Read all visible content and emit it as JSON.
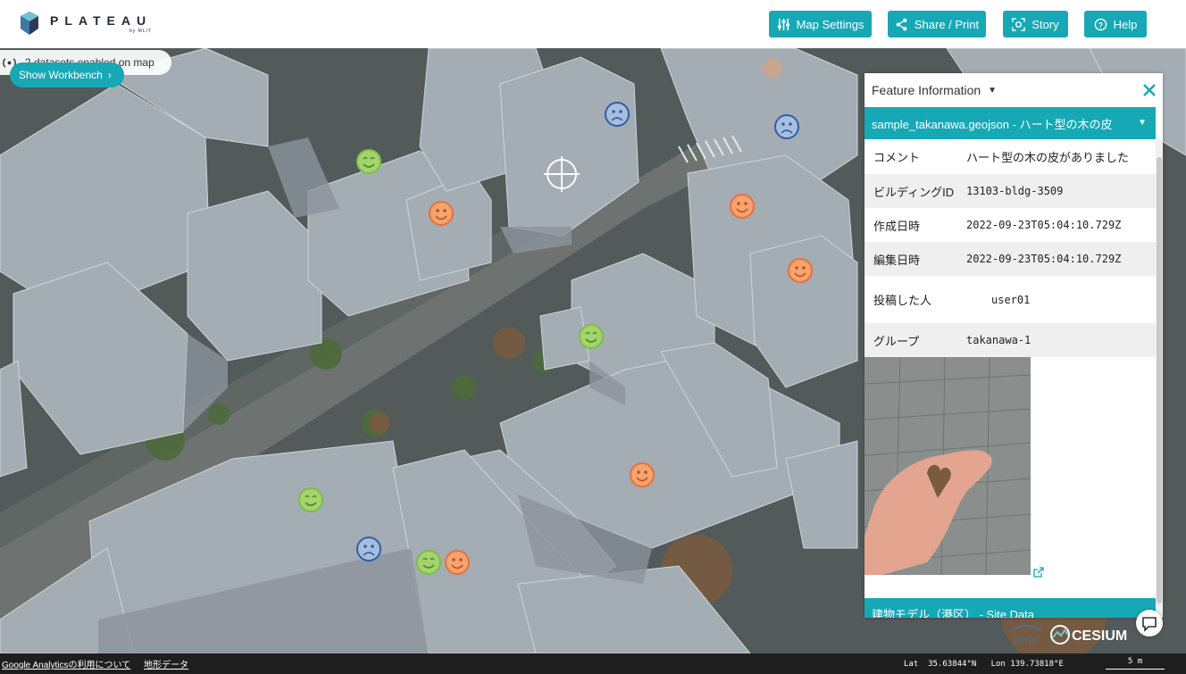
{
  "app": {
    "logo_title": "PLATEAU",
    "logo_sub": "by MLIT",
    "accent": "#17a8b5"
  },
  "header": {
    "buttons": [
      {
        "label": "Map Settings",
        "icon": "sliders-icon"
      },
      {
        "label": "Share / Print",
        "icon": "share-icon"
      },
      {
        "label": "Story",
        "icon": "story-icon"
      },
      {
        "label": "Help",
        "icon": "help-icon"
      }
    ]
  },
  "map": {
    "datasets_text": "2 datasets enabled on map",
    "workbench_label": "Show Workbench",
    "marker_colors": {
      "happy": "#7ac043",
      "smile": "#e8703a",
      "sad": "#2f5fa8"
    }
  },
  "feature_panel": {
    "title": "Feature Information",
    "dataset_title": "sample_takanawa.geojson - ハート型の木の皮",
    "rows": [
      {
        "key": "コメント",
        "value": "ハート型の木の皮がありました"
      },
      {
        "key": "ビルディングID",
        "value": "13103-bldg-3509"
      },
      {
        "key": "作成日時",
        "value": "2022-09-23T05:04:10.729Z"
      },
      {
        "key": "編集日時",
        "value": "2022-09-23T05:04:10.729Z"
      },
      {
        "key": "投稿した人",
        "value": "user01"
      },
      {
        "key": "グループ",
        "value": "takanawa-1"
      }
    ],
    "second_dataset_title": "建物モデル（港区） - Site Data"
  },
  "logos": {
    "terria": "terria",
    "cesium": "CESIUM"
  },
  "footer": {
    "analytics_link": "Google Analyticsの利用について",
    "terrain_link": "地形データ",
    "lat_label": "Lat",
    "lat_value": "35.63844°N",
    "lon_label": "Lon",
    "lon_value": "139.73818°E",
    "scale": "5 m"
  }
}
